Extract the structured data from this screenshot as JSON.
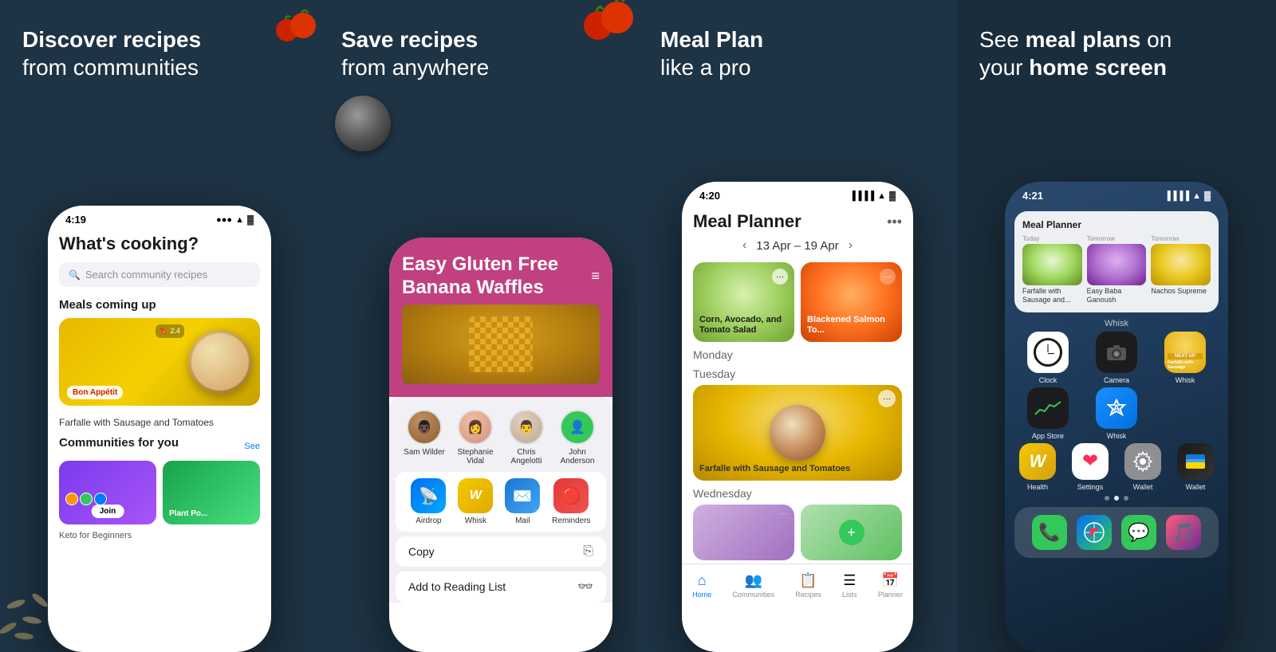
{
  "panels": [
    {
      "id": "panel1",
      "heading_line1": "Discover recipes",
      "heading_line2": "from communities",
      "phone": {
        "status_time": "4:19",
        "title": "What's cooking?",
        "search_placeholder": "Search community recipes",
        "section1": "Meals coming up",
        "meal_brand": "Bon Appétit",
        "meal_label": "Farfalle with Sausage and Tomatoes",
        "section2": "Communities for you",
        "section2_link": "See",
        "community1": "Keto for Beginners",
        "community2": "Plant Po...",
        "join_label": "Join"
      }
    },
    {
      "id": "panel2",
      "heading_line1": "Save recipes",
      "heading_line2": "from anywhere",
      "phone": {
        "status_time": "—",
        "recipe_title": "Easy Gluten Free Banana Waffles",
        "contacts": [
          "Sam Wilder",
          "Stephanie Vidal",
          "Chris Angelotti",
          "John Anderson"
        ],
        "apps": [
          "Airdrop",
          "Whisk",
          "Mail",
          "Reminders"
        ],
        "action1": "Copy",
        "action2": "Add to Reading List"
      }
    },
    {
      "id": "panel3",
      "heading_line1": "Meal Plan",
      "heading_line2": "like a pro",
      "phone": {
        "status_time": "4:20",
        "title": "Meal Planner",
        "date_range": "13 Apr – 19 Apr",
        "recipes": [
          {
            "label": "Corn, Avocado, and Tomato Salad",
            "color": "green"
          },
          {
            "label": "Blackened Salmon To...",
            "color": "orange"
          }
        ],
        "day1": "Monday",
        "day2": "Tuesday",
        "day1_recipe": "Farfalle with Sausage and Tomatoes",
        "day3": "Wednesday",
        "nav_items": [
          "Home",
          "Communities",
          "Recipes",
          "Lists",
          "Planner"
        ]
      }
    },
    {
      "id": "panel4",
      "heading_line1": "See ",
      "heading_bold": "meal plans",
      "heading_line2": " on",
      "heading_line3": "your ",
      "heading_bold2": "home screen",
      "phone": {
        "status_time": "4:21",
        "widget": {
          "title": "Meal Planner",
          "meals": [
            {
              "tag": "Today",
              "label": "Farfalle with Sausage and..."
            },
            {
              "tag": "Tomorrow",
              "label": "Easy Baba Ganoush"
            },
            {
              "tag": "Tomorrow",
              "label": "Nachos Supreme"
            }
          ]
        },
        "section_label": "Whisk",
        "apps": [
          {
            "name": "Clock",
            "type": "clock"
          },
          {
            "name": "Camera",
            "type": "camera"
          },
          {
            "name": "Next Up",
            "type": "next-up"
          },
          {
            "name": "Stocks",
            "type": "stocks"
          },
          {
            "name": "App Store",
            "type": "appstore"
          },
          {
            "name": "Whisk",
            "type": "whisk"
          },
          {
            "name": "Health",
            "type": "health"
          },
          {
            "name": "Settings",
            "type": "settings"
          },
          {
            "name": "Wallet",
            "type": "wallet"
          }
        ],
        "dock_apps": [
          "Phone",
          "Safari",
          "Messages",
          "Music"
        ]
      }
    }
  ]
}
